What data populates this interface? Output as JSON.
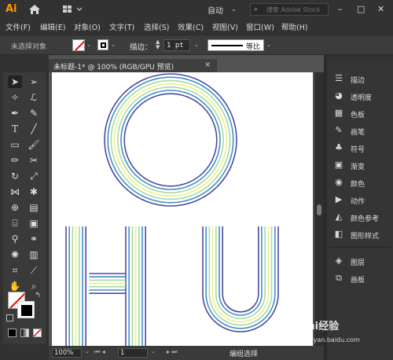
{
  "app": {
    "logo_text": "Ai",
    "workspace": "自动",
    "search_placeholder": "搜索 Adobe Stock",
    "window_minimize": "–",
    "window_maximize": "□",
    "window_close": "✕"
  },
  "menu": [
    "文件(F)",
    "编辑(E)",
    "对象(O)",
    "文字(T)",
    "选择(S)",
    "效果(C)",
    "视图(V)",
    "窗口(W)",
    "帮助(H)"
  ],
  "control": {
    "no_selection": "未选择对象",
    "stroke_label": "描边：",
    "stroke_value": "1 pt",
    "profile_label": "等比"
  },
  "document": {
    "tab_title": "未标题-1* @ 100% (RGB/GPU 预览)",
    "tab_close": "×"
  },
  "status": {
    "zoom": "100%",
    "artboard": "1",
    "text": "编组选择"
  },
  "right_panels": [
    {
      "label": "描边",
      "icon": "stroke-lines-icon"
    },
    {
      "label": "透明度",
      "icon": "transparency-icon"
    },
    {
      "label": "色板",
      "icon": "swatches-icon"
    },
    {
      "label": "画笔",
      "icon": "brushes-icon"
    },
    {
      "label": "符号",
      "icon": "symbols-club-icon"
    },
    {
      "label": "渐变",
      "icon": "gradient-icon"
    },
    {
      "label": "颜色",
      "icon": "color-palette-icon"
    },
    {
      "label": "动作",
      "icon": "play-actions-icon"
    },
    {
      "label": "颜色参考",
      "icon": "color-guide-icon"
    },
    {
      "label": "图形样式",
      "icon": "graphic-styles-icon"
    },
    {
      "label": "图层",
      "icon": "layers-icon"
    },
    {
      "label": "画板",
      "icon": "artboards-icon"
    }
  ],
  "artwork": {
    "letters": [
      "O",
      "H",
      "U"
    ],
    "stroke_colors": [
      "#4b4b9e",
      "#3f8fc9",
      "#a8d9a0",
      "#e9f08a",
      "#a8d9a0",
      "#3f8fc9",
      "#4b4b9e"
    ]
  },
  "watermark": {
    "logo": "Bai经验",
    "url": "jingyan.baidu.com"
  }
}
